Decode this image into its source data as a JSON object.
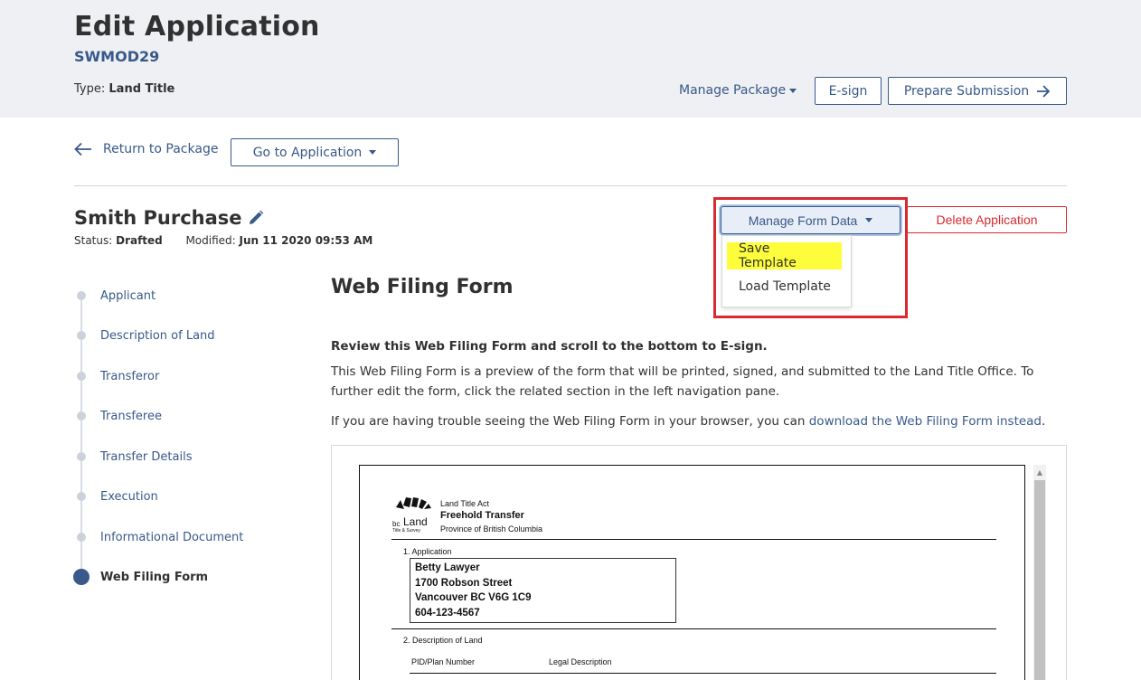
{
  "header": {
    "title": "Edit Application",
    "code": "SWMOD29",
    "type_label": "Type:",
    "type_value": "Land Title",
    "manage_package": "Manage Package",
    "esign": "E-sign",
    "prepare_submission": "Prepare Submission"
  },
  "toolbar": {
    "return_link": "Return to Package",
    "go_to_application": "Go to Application"
  },
  "application": {
    "name": "Smith Purchase",
    "status_label": "Status:",
    "status_value": "Drafted",
    "modified_label": "Modified:",
    "modified_value": "Jun 11 2020 09:53 AM",
    "manage_form_data": "Manage Form Data",
    "delete_application": "Delete Application",
    "dropdown": [
      "Save Template",
      "Load Template"
    ]
  },
  "nav": {
    "items": [
      "Applicant",
      "Description of Land",
      "Transferor",
      "Transferee",
      "Transfer Details",
      "Execution",
      "Informational Document",
      "Web Filing Form"
    ],
    "active_index": 7
  },
  "main": {
    "title": "Web Filing Form",
    "review_heading": "Review this Web Filing Form and scroll to the bottom to E-sign.",
    "review_body": "This Web Filing Form is a preview of the form that will be printed, signed, and submitted to the Land Title Office. To further edit the form, click the related section in the left navigation pane.",
    "trouble_prefix": "If you are having trouble seeing the Web Filing Form in your browser, you can ",
    "trouble_link": "download the Web Filing Form instead",
    "trouble_suffix": "."
  },
  "form_preview": {
    "logo_text_top": "bc",
    "logo_text_main": "Land",
    "logo_text_sub": "Title & Survey",
    "act": "Land Title Act",
    "form_name": "Freehold Transfer",
    "province": "Province of British Columbia",
    "section1": "1. Application",
    "applicant_lines": [
      "Betty Lawyer",
      "1700 Robson Street",
      "Vancouver BC V6G 1C9",
      "604-123-4567"
    ],
    "section2": "2. Description of Land",
    "col_pid": "PID/Plan Number",
    "col_legal": "Legal Description"
  },
  "colors": {
    "primary": "#38598a",
    "danger": "#d8292f",
    "highlight": "#fdfd3c",
    "header_bg": "#eef0f3"
  },
  "icons": [
    "arrow-left-icon",
    "arrow-right-icon",
    "pencil-icon",
    "caret-down-icon"
  ]
}
